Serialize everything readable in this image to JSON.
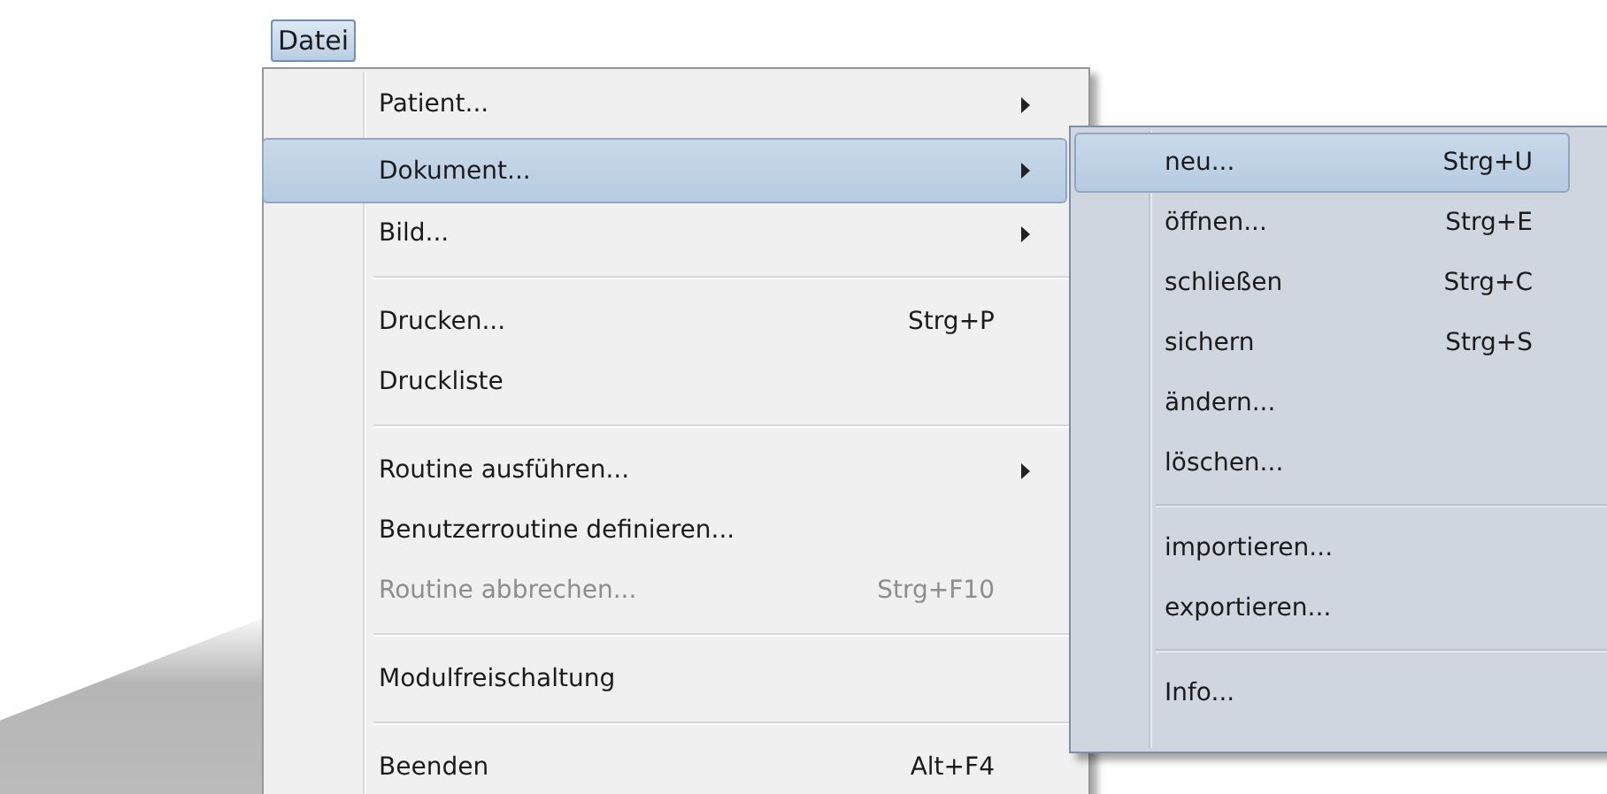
{
  "menu_bar": [
    {
      "label": "Datei",
      "selected": true
    }
  ],
  "menu": {
    "items": [
      {
        "kind": "item",
        "label": "Patient...",
        "has_submenu": true,
        "disabled": false,
        "selected": false
      },
      {
        "kind": "item",
        "label": "Dokument...",
        "has_submenu": true,
        "disabled": false,
        "selected": true
      },
      {
        "kind": "item",
        "label": "Bild...",
        "has_submenu": true,
        "disabled": false,
        "selected": false
      },
      {
        "kind": "separator"
      },
      {
        "kind": "item",
        "label": "Drucken...",
        "shortcut": "Strg+P",
        "has_submenu": false,
        "disabled": false,
        "selected": false
      },
      {
        "kind": "item",
        "label": "Druckliste",
        "has_submenu": false,
        "disabled": false,
        "selected": false
      },
      {
        "kind": "separator"
      },
      {
        "kind": "item",
        "label": "Routine ausführen...",
        "has_submenu": true,
        "disabled": false,
        "selected": false
      },
      {
        "kind": "item",
        "label": "Benutzerroutine definieren...",
        "has_submenu": false,
        "disabled": false,
        "selected": false
      },
      {
        "kind": "item",
        "label": "Routine abbrechen...",
        "shortcut": "Strg+F10",
        "has_submenu": false,
        "disabled": true,
        "selected": false
      },
      {
        "kind": "separator"
      },
      {
        "kind": "item",
        "label": "Modulfreischaltung",
        "has_submenu": false,
        "disabled": false,
        "selected": false
      },
      {
        "kind": "separator"
      },
      {
        "kind": "item",
        "label": "Beenden",
        "shortcut": "Alt+F4",
        "has_submenu": false,
        "disabled": false,
        "selected": false
      }
    ]
  },
  "submenu": {
    "items": [
      {
        "kind": "item",
        "label": "neu...",
        "shortcut": "Strg+U",
        "disabled": false,
        "selected": true
      },
      {
        "kind": "item",
        "label": "öffnen...",
        "shortcut": "Strg+E",
        "disabled": false,
        "selected": false
      },
      {
        "kind": "item",
        "label": "schließen",
        "shortcut": "Strg+C",
        "disabled": false,
        "selected": false
      },
      {
        "kind": "item",
        "label": "sichern",
        "shortcut": "Strg+S",
        "disabled": false,
        "selected": false
      },
      {
        "kind": "item",
        "label": "ändern...",
        "disabled": false,
        "selected": false
      },
      {
        "kind": "item",
        "label": "löschen...",
        "disabled": false,
        "selected": false
      },
      {
        "kind": "separator"
      },
      {
        "kind": "item",
        "label": "importieren...",
        "disabled": false,
        "selected": false
      },
      {
        "kind": "item",
        "label": "exportieren...",
        "disabled": false,
        "selected": false
      },
      {
        "kind": "separator"
      },
      {
        "kind": "item",
        "label": "Info...",
        "disabled": false,
        "selected": false
      }
    ]
  }
}
